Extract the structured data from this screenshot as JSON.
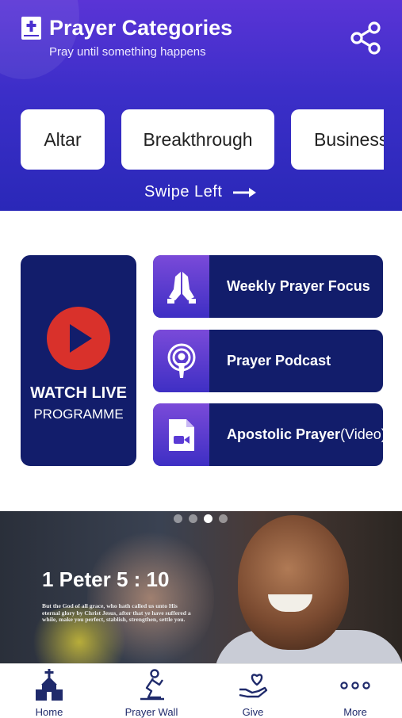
{
  "header": {
    "title": "Prayer Categories",
    "subtitle": "Pray until something happens",
    "swipe_hint": "Swipe Left"
  },
  "categories": [
    "Altar",
    "Breakthrough",
    "Business"
  ],
  "live": {
    "line1": "WATCH LIVE",
    "line2": "PROGRAMME"
  },
  "features": [
    {
      "label": "Weekly Prayer Focus",
      "suffix": "",
      "icon": "praying-hands-icon"
    },
    {
      "label": "Prayer Podcast",
      "suffix": "",
      "icon": "podcast-icon"
    },
    {
      "label": "Apostolic Prayer",
      "suffix": " (Video)",
      "icon": "video-file-icon"
    }
  ],
  "banner": {
    "reference": "1 Peter 5 : 10",
    "verse": "But the God of all grace, who hath called us unto His eternal glory by Christ Jesus, after that ye have suffered a while, make you perfect, stablish, strengthen, settle you.",
    "slide_count": 4,
    "active_slide": 3
  },
  "nav": [
    {
      "label": "Home",
      "icon": "church-icon"
    },
    {
      "label": "Prayer Wall",
      "icon": "kneeling-person-icon"
    },
    {
      "label": "Give",
      "icon": "hand-heart-icon"
    },
    {
      "label": "More",
      "icon": "more-dots-icon"
    }
  ],
  "colors": {
    "header_top": "#5a34d6",
    "header_bottom": "#2a28b8",
    "tile_navy": "#121d6b",
    "play_red": "#d9312b",
    "nav_text": "#1f2a6b"
  }
}
